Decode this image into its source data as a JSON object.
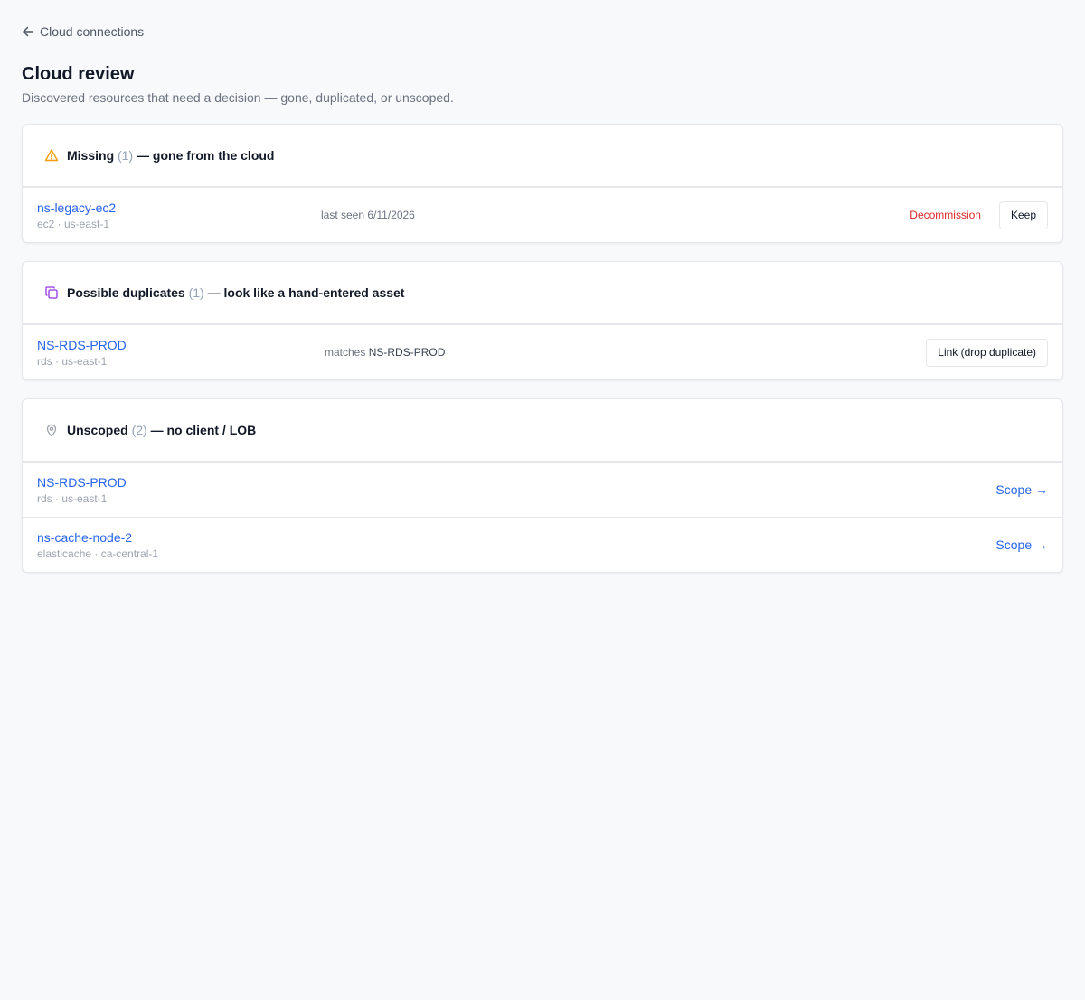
{
  "nav": {
    "back_label": "Cloud connections"
  },
  "page": {
    "title": "Cloud review",
    "subtitle": "Discovered resources that need a decision — gone, duplicated, or unscoped."
  },
  "sections": {
    "missing": {
      "title": "Missing",
      "count": "(1)",
      "suffix": "— gone from the cloud",
      "icon": "warning-triangle-icon",
      "icon_color": "#f59e0b",
      "items": [
        {
          "name": "ns-legacy-ec2",
          "meta": "ec2 · us-east-1",
          "last_seen": "last seen 6/11/2026",
          "decommission_label": "Decommission",
          "keep_label": "Keep"
        }
      ]
    },
    "duplicates": {
      "title": "Possible duplicates",
      "count": "(1)",
      "suffix": "— look like a hand-entered asset",
      "icon": "copy-icon",
      "icon_color": "#9333ea",
      "items": [
        {
          "name": "NS-RDS-PROD",
          "meta": "rds · us-east-1",
          "matches_prefix": "matches",
          "matches_value": "NS-RDS-PROD",
          "link_label": "Link (drop duplicate)"
        }
      ]
    },
    "unscoped": {
      "title": "Unscoped",
      "count": "(2)",
      "suffix": "— no client / LOB",
      "icon": "map-pin-icon",
      "icon_color": "#9ca3af",
      "items": [
        {
          "name": "NS-RDS-PROD",
          "meta": "rds · us-east-1",
          "scope_label": "Scope →"
        },
        {
          "name": "ns-cache-node-2",
          "meta": "elasticache · ca-central-1",
          "scope_label": "Scope →"
        }
      ]
    }
  },
  "colors": {
    "link": "#2563eb",
    "danger": "#dc2626",
    "background": "#f8f9fb"
  }
}
